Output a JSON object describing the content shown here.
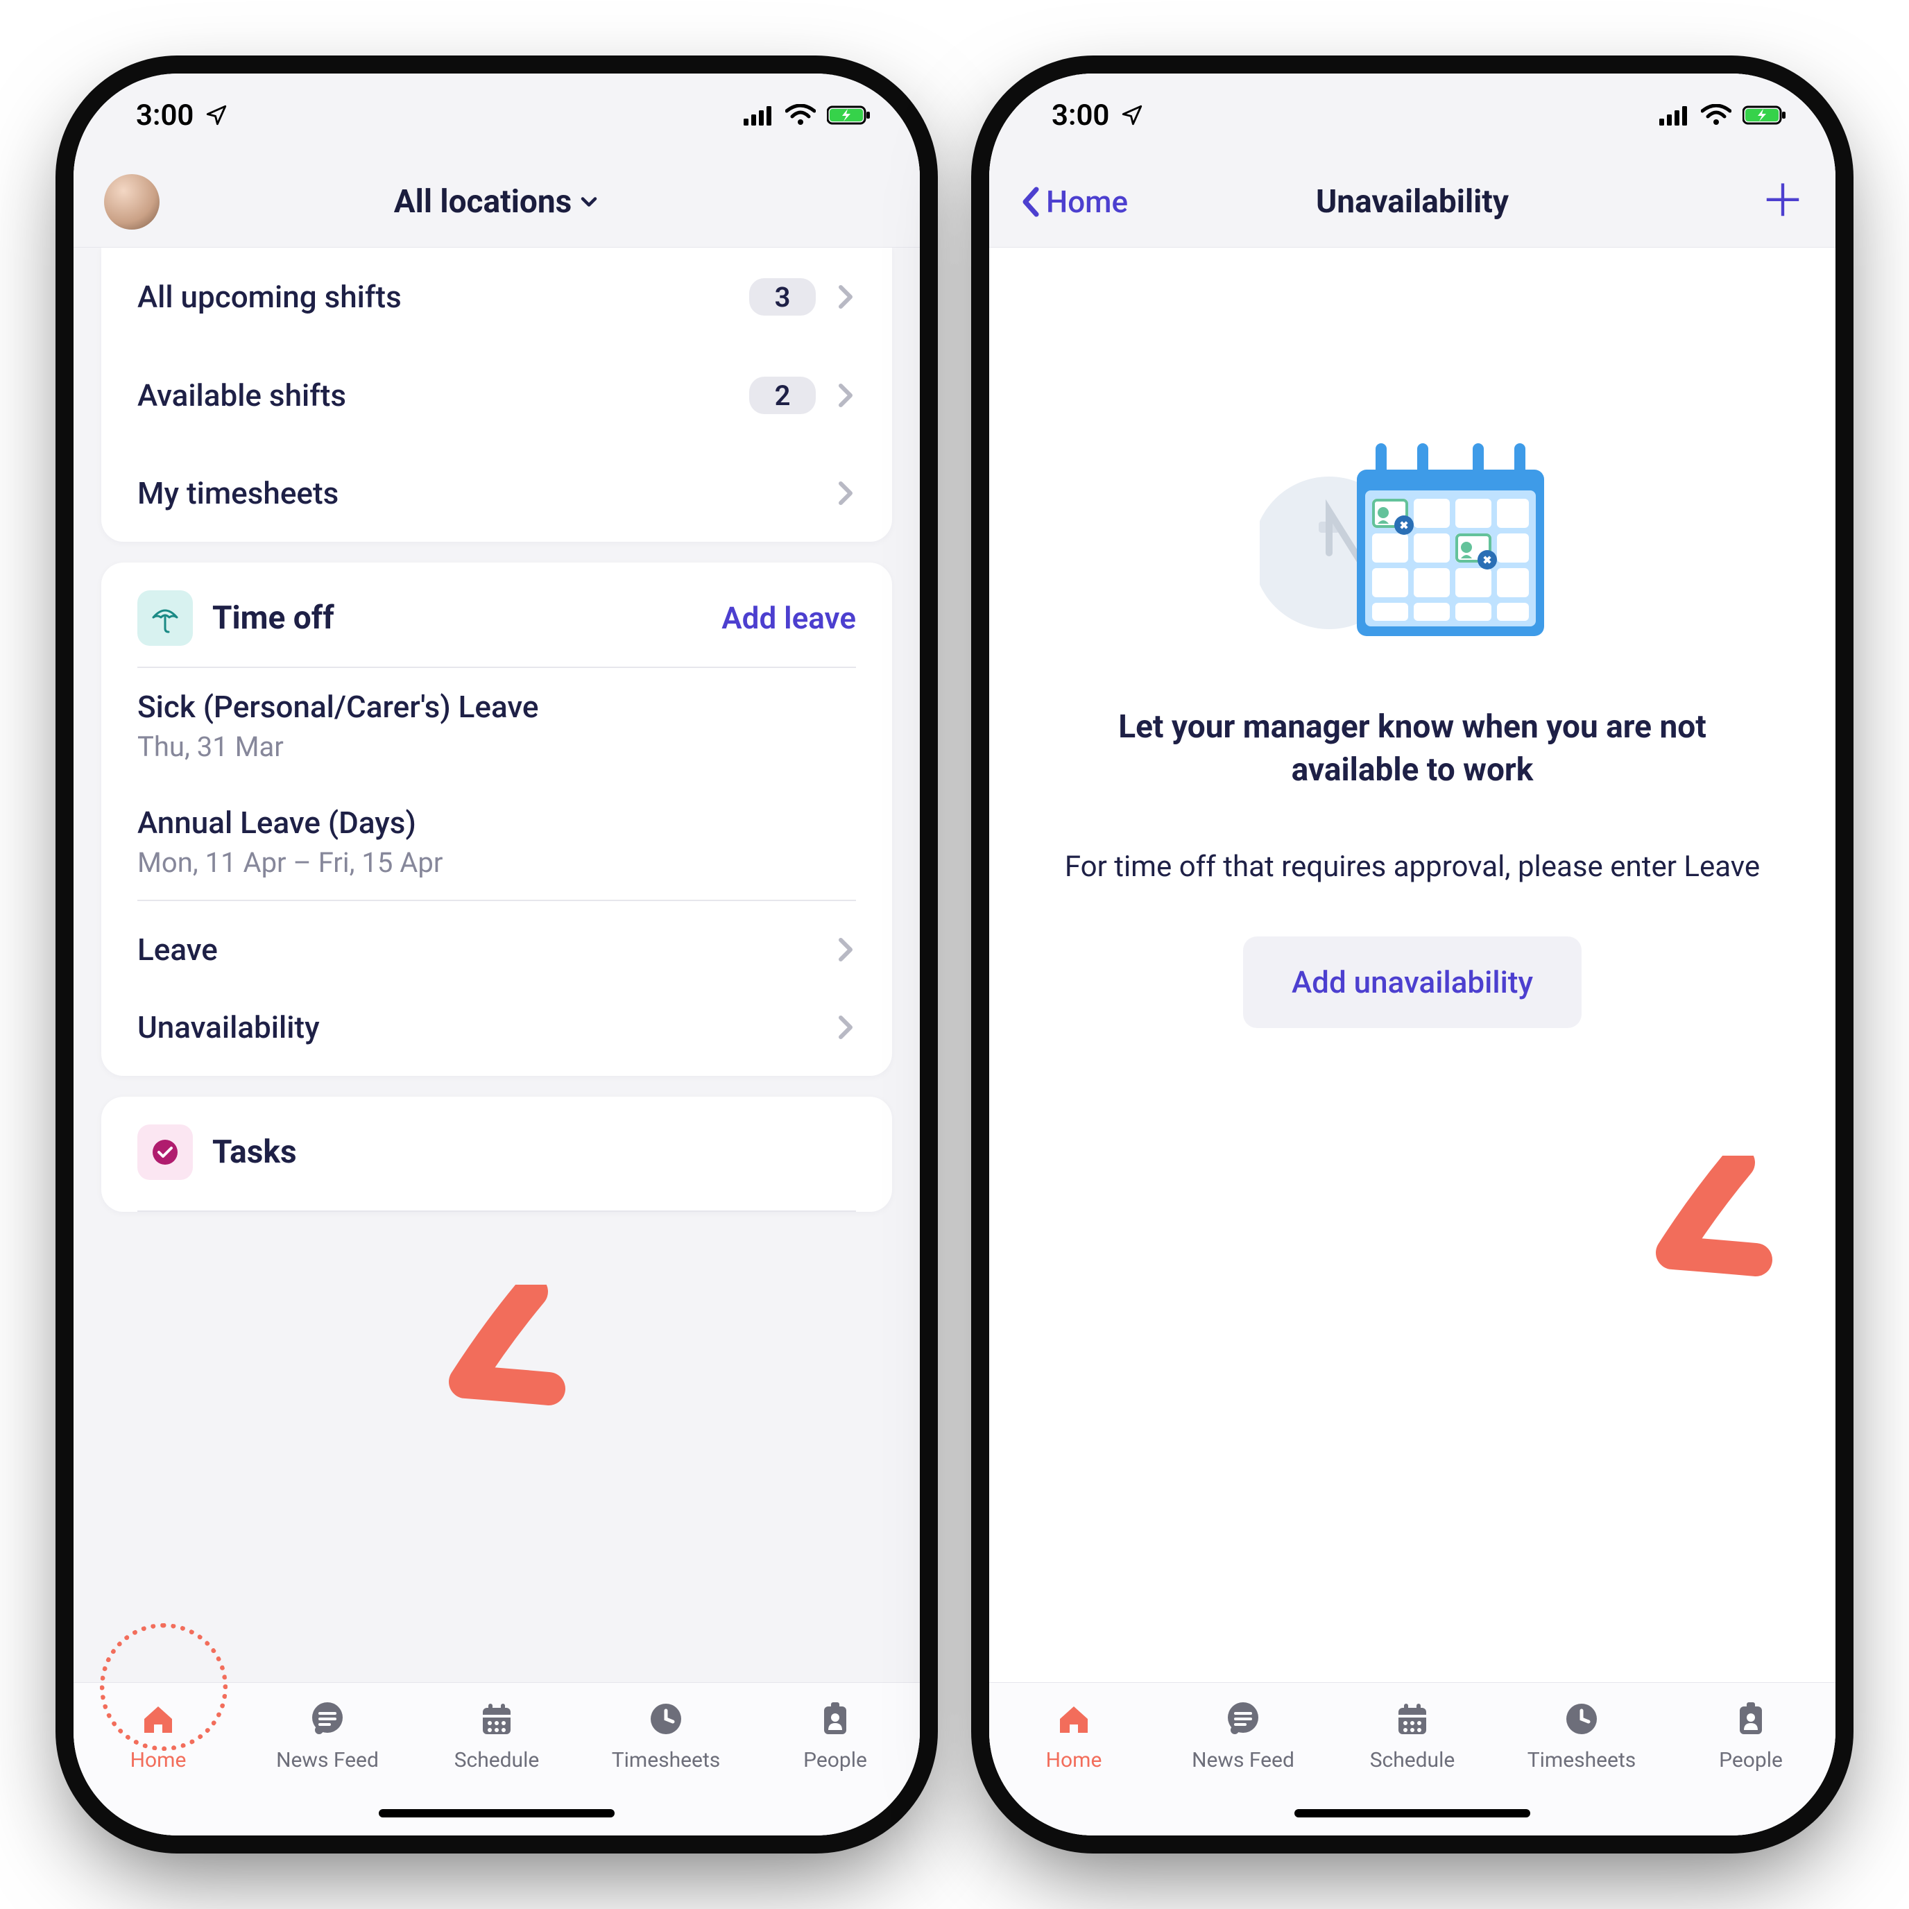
{
  "status": {
    "time": "3:00"
  },
  "left_phone": {
    "nav": {
      "title": "All locations"
    },
    "shifts": {
      "upcoming": {
        "label": "All upcoming shifts",
        "count": "3"
      },
      "available": {
        "label": "Available shifts",
        "count": "2"
      },
      "timesheets": {
        "label": "My timesheets"
      }
    },
    "timeoff": {
      "title": "Time off",
      "action": "Add leave",
      "items": [
        {
          "title": "Sick (Personal/Carer's) Leave",
          "date": "Thu, 31 Mar"
        },
        {
          "title": "Annual Leave (Days)",
          "date": "Mon, 11 Apr – Fri, 15 Apr"
        }
      ],
      "links": {
        "leave": "Leave",
        "unavail": "Unavailability"
      }
    },
    "tasks": {
      "title": "Tasks"
    }
  },
  "right_phone": {
    "nav": {
      "back": "Home",
      "title": "Unavailability"
    },
    "empty": {
      "headline": "Let your manager know when you are not available to work",
      "sub": "For time off that requires approval, please enter Leave",
      "button": "Add unavailability"
    }
  },
  "tabs": {
    "home": "Home",
    "news": "News Feed",
    "schedule": "Schedule",
    "timesheets": "Timesheets",
    "people": "People"
  }
}
